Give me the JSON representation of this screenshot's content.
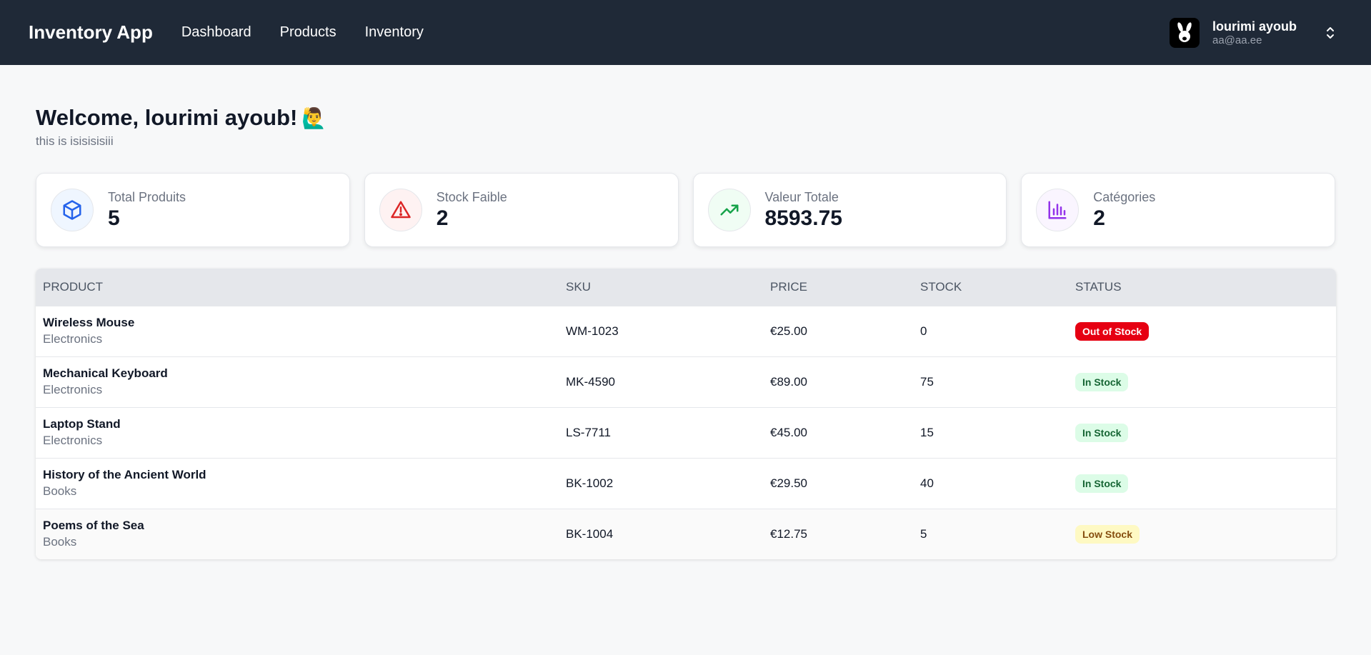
{
  "nav": {
    "brand": "Inventory App",
    "links": [
      "Dashboard",
      "Products",
      "Inventory"
    ]
  },
  "user": {
    "name": "lourimi ayoub",
    "email": "aa@aa.ee",
    "avatar_icon": "rabbit-icon",
    "menu_icon": "chevron-up-down-icon"
  },
  "welcome": {
    "title": "Welcome, lourimi ayoub!",
    "emoji": "🙋‍♂️",
    "subtitle": "this is isisisisiii"
  },
  "stats": [
    {
      "label": "Total Produits",
      "value": "5",
      "icon": "box-icon",
      "color": "#2563eb",
      "bg": "#eff6ff"
    },
    {
      "label": "Stock Faible",
      "value": "2",
      "icon": "warning-icon",
      "color": "#dc2626",
      "bg": "#fef2f2"
    },
    {
      "label": "Valeur Totale",
      "value": "8593.75",
      "icon": "trending-up-icon",
      "color": "#16a34a",
      "bg": "#f0fdf4"
    },
    {
      "label": "Catégories",
      "value": "2",
      "icon": "bar-chart-icon",
      "color": "#9333ea",
      "bg": "#faf5ff"
    }
  ],
  "table": {
    "headers": [
      "PRODUCT",
      "SKU",
      "PRICE",
      "STOCK",
      "STATUS"
    ],
    "rows": [
      {
        "name": "Wireless Mouse",
        "category": "Electronics",
        "sku": "WM-1023",
        "price": "€25.00",
        "stock": "0",
        "status": "Out of Stock",
        "status_type": "out"
      },
      {
        "name": "Mechanical Keyboard",
        "category": "Electronics",
        "sku": "MK-4590",
        "price": "€89.00",
        "stock": "75",
        "status": "In Stock",
        "status_type": "in"
      },
      {
        "name": "Laptop Stand",
        "category": "Electronics",
        "sku": "LS-7711",
        "price": "€45.00",
        "stock": "15",
        "status": "In Stock",
        "status_type": "in"
      },
      {
        "name": "History of the Ancient World",
        "category": "Books",
        "sku": "BK-1002",
        "price": "€29.50",
        "stock": "40",
        "status": "In Stock",
        "status_type": "in"
      },
      {
        "name": "Poems of the Sea",
        "category": "Books",
        "sku": "BK-1004",
        "price": "€12.75",
        "stock": "5",
        "status": "Low Stock",
        "status_type": "low"
      }
    ]
  },
  "status_colors": {
    "out": {
      "bg": "#e60012",
      "fg": "#ffffff"
    },
    "in": {
      "bg": "#dcfce7",
      "fg": "#166534"
    },
    "low": {
      "bg": "#fef9c3",
      "fg": "#854d0e"
    }
  }
}
